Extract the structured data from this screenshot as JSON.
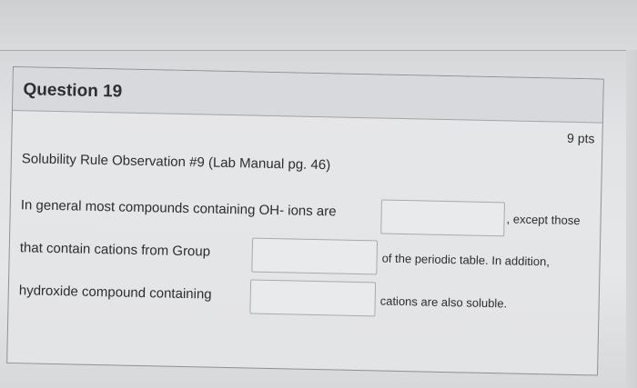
{
  "previous": {
    "tail_text": "..."
  },
  "question": {
    "title": "Question 19",
    "points": "9 pts",
    "observation": "Solubility Rule Observation #9 (Lab Manual pg. 46)",
    "line1": "In general most compounds containing OH- ions are",
    "line1_after": ", except those",
    "line2": "that contain cations from Group",
    "line2_after": "of the periodic table. In addition,",
    "line3": "hydroxide compound containing",
    "line3_after": "cations are also soluble."
  },
  "inputs": {
    "blank1": "",
    "blank2": "",
    "blank3": ""
  }
}
